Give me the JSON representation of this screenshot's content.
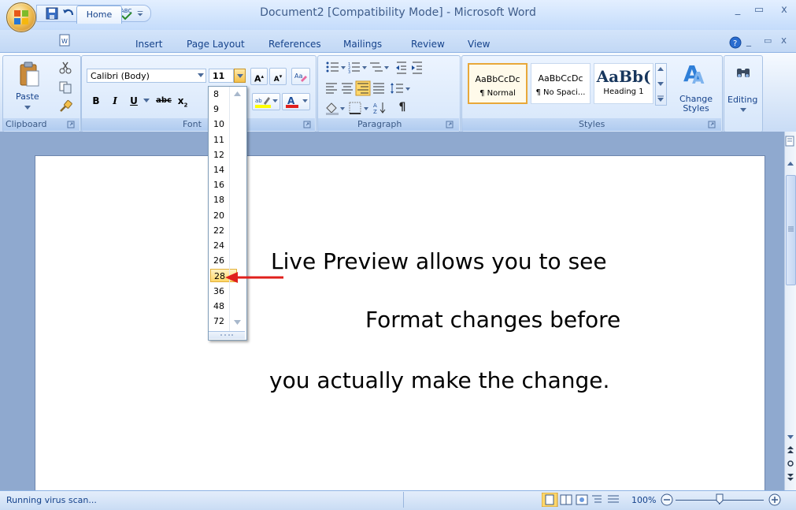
{
  "window": {
    "title": "Document2 [Compatibility Mode] - Microsoft Word",
    "minimize_glyph": "_",
    "restore_glyph": "▭",
    "close_glyph": "x"
  },
  "tabs": [
    "Home",
    "Insert",
    "Page Layout",
    "References",
    "Mailings",
    "Review",
    "View"
  ],
  "clipboard": {
    "paste_label": "Paste",
    "group_label": "Clipboard"
  },
  "font": {
    "name_value": "Calibri (Body)",
    "size_value": "11",
    "bold": "B",
    "italic": "I",
    "underline": "U",
    "strike": "abc",
    "subscript": "x",
    "grow": "A",
    "shrink": "A",
    "group_label": "Font"
  },
  "paragraph": {
    "group_label": "Paragraph",
    "pilcrow": "¶"
  },
  "styles": {
    "items": [
      {
        "sample": "AaBbCcDc",
        "name": "¶ Normal"
      },
      {
        "sample": "AaBbCcDc",
        "name": "¶ No Spaci..."
      },
      {
        "sample": "AaBb(",
        "name": "Heading 1"
      }
    ],
    "change_styles_label": "Change Styles",
    "group_label": "Styles"
  },
  "editing": {
    "label": "Editing"
  },
  "size_dropdown": {
    "options": [
      "8",
      "9",
      "10",
      "11",
      "12",
      "14",
      "16",
      "18",
      "20",
      "22",
      "24",
      "26",
      "28",
      "36",
      "48",
      "72"
    ],
    "highlighted": "28"
  },
  "document": {
    "lines": [
      "Live Preview allows you to see",
      "Format changes before",
      "you actually make the change."
    ]
  },
  "status": {
    "text": "Running virus scan...",
    "zoom": "100%"
  },
  "colors": {
    "accent": "#15428b",
    "highlight": "#ffe38a",
    "arrow": "#e0201c",
    "doc_bg": "#8fa9cf"
  }
}
